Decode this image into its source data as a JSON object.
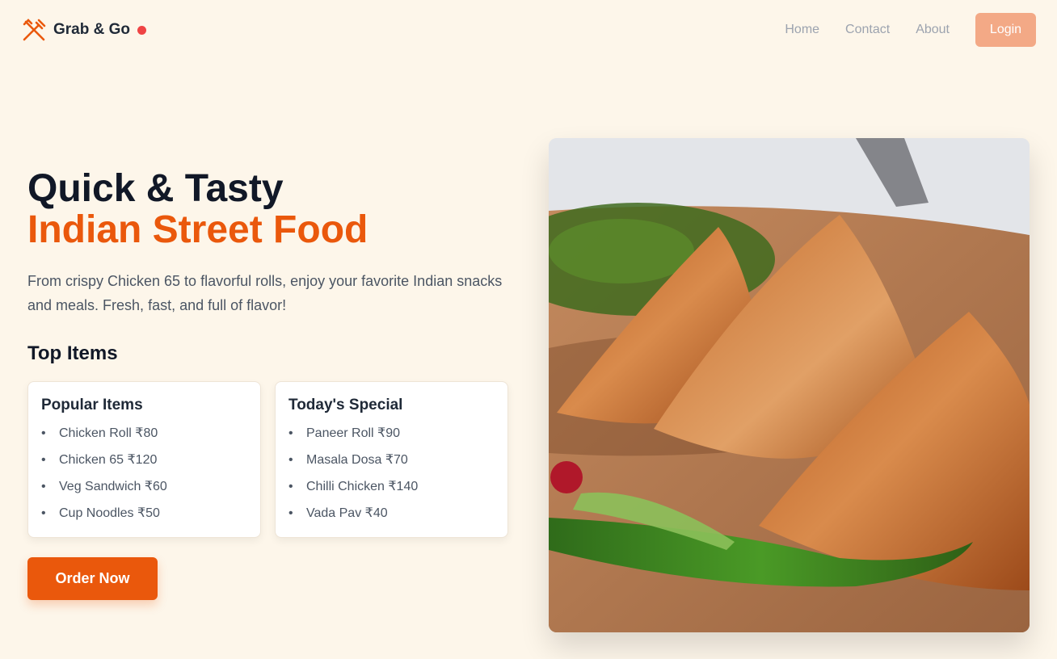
{
  "header": {
    "brand": "Grab & Go",
    "nav": {
      "home": "Home",
      "contact": "Contact",
      "about": "About"
    },
    "login_label": "Login"
  },
  "hero": {
    "title_line1": "Quick & Tasty",
    "title_line2": "Indian Street Food",
    "description": "From crispy Chicken 65 to flavorful rolls, enjoy your favorite Indian snacks and meals. Fresh, fast, and full of flavor!",
    "top_items_title": "Top Items",
    "cards": [
      {
        "title": "Popular Items",
        "items": [
          "Chicken Roll ₹80",
          "Chicken 65 ₹120",
          "Veg Sandwich ₹60",
          "Cup Noodles ₹50"
        ]
      },
      {
        "title": "Today's Special",
        "items": [
          "Paneer Roll ₹90",
          "Masala Dosa ₹70",
          "Chilli Chicken ₹140",
          "Vada Pav ₹40"
        ]
      }
    ],
    "order_label": "Order Now"
  },
  "colors": {
    "accent": "#ea580c",
    "login_button": "#f3a986",
    "background": "#fdf6ea",
    "status_dot": "#ef4444"
  },
  "icons": {
    "logo": "utensils-crossed-icon"
  }
}
